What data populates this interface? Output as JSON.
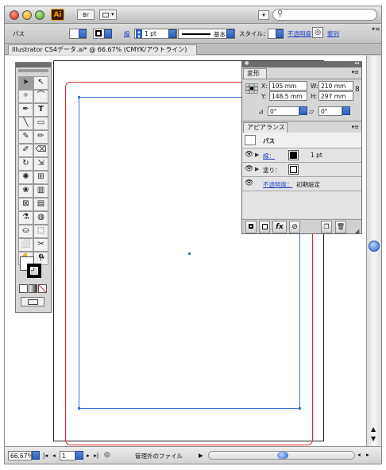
{
  "titlebar": {
    "app_badge": "Ai",
    "bridge_label": "Br",
    "search_placeholder": ""
  },
  "control_bar": {
    "object_type": "パス",
    "stroke_label": "線",
    "stroke_weight": "1 pt",
    "brush_label": "基本",
    "style_label": "スタイル：",
    "opacity_label": "不透明度",
    "align_label": "整列"
  },
  "document": {
    "tab_title": "Illustrator CS4データ.ai* @ 66.67% (CMYK/アウトライン)"
  },
  "transform_panel": {
    "tab": "変形",
    "x_label": "X:",
    "x_value": "105 mm",
    "w_label": "W:",
    "w_value": "210 mm",
    "y_label": "Y:",
    "y_value": "148.5 mm",
    "h_label": "H:",
    "h_value": "297 mm",
    "rotate_value": "0°",
    "shear_value": "0°"
  },
  "appearance_panel": {
    "tab": "アピアランス",
    "object_label": "パス",
    "stroke_label": "線：",
    "stroke_weight": "1 pt",
    "fill_label": "塗り：",
    "opacity_label": "不透明度：",
    "opacity_value": "初期設定"
  },
  "status_bar": {
    "zoom": "66.67%",
    "page": "1",
    "status_text": "管理外のファイル"
  },
  "colors": {
    "accent": "#2f5fb8",
    "bleed": "#e0262a",
    "selection": "#3a6fd6"
  }
}
